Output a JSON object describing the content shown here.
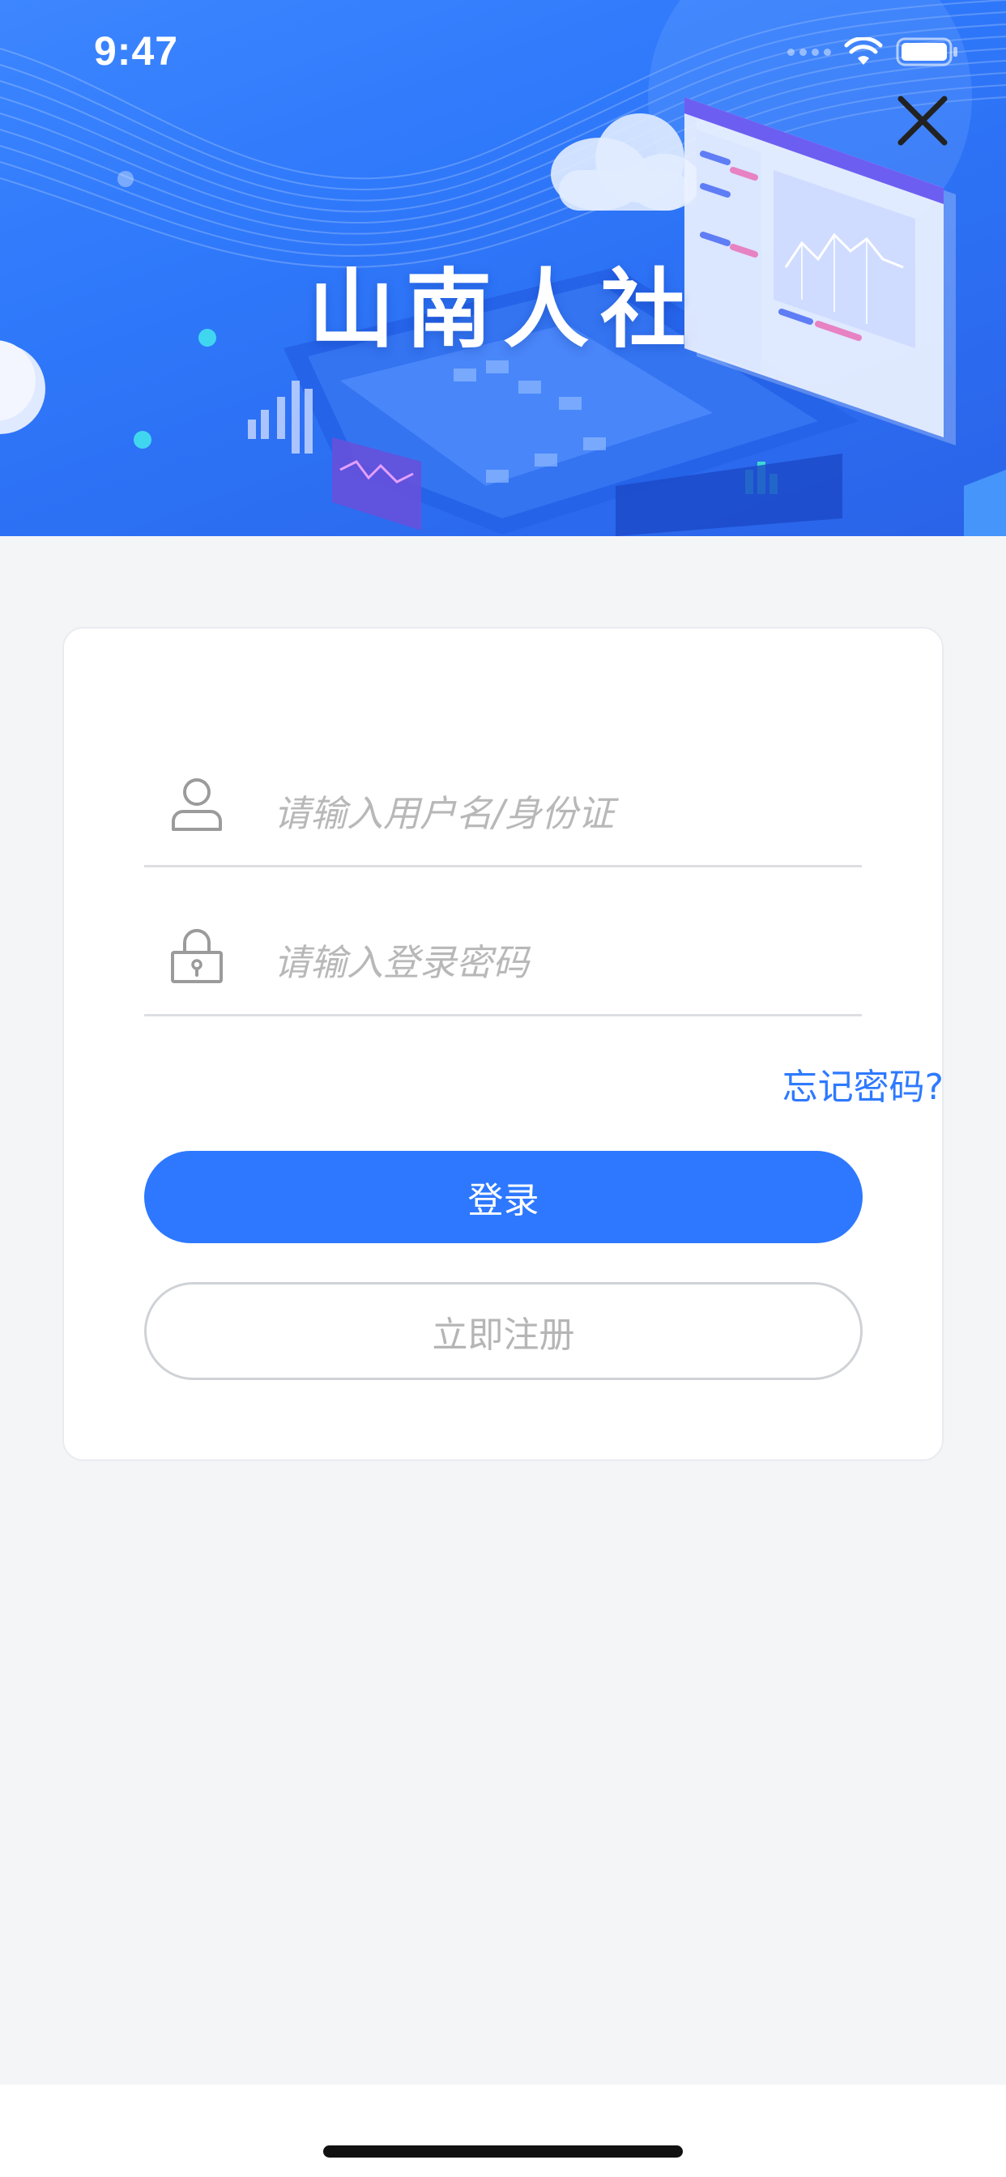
{
  "status_bar": {
    "time": "9:47"
  },
  "header": {
    "title": "山南人社",
    "close_icon": "close-icon"
  },
  "login_form": {
    "username": {
      "placeholder": "请输入用户名/身份证",
      "value": "",
      "icon": "user-icon"
    },
    "password": {
      "placeholder": "请输入登录密码",
      "value": "",
      "icon": "lock-icon"
    },
    "forgot_password_label": "忘记密码?",
    "login_label": "登录",
    "register_label": "立即注册"
  },
  "colors": {
    "primary": "#2d78ff",
    "link": "#2e7aff",
    "background": "#f4f5f7",
    "placeholder": "#b8b8b8"
  }
}
